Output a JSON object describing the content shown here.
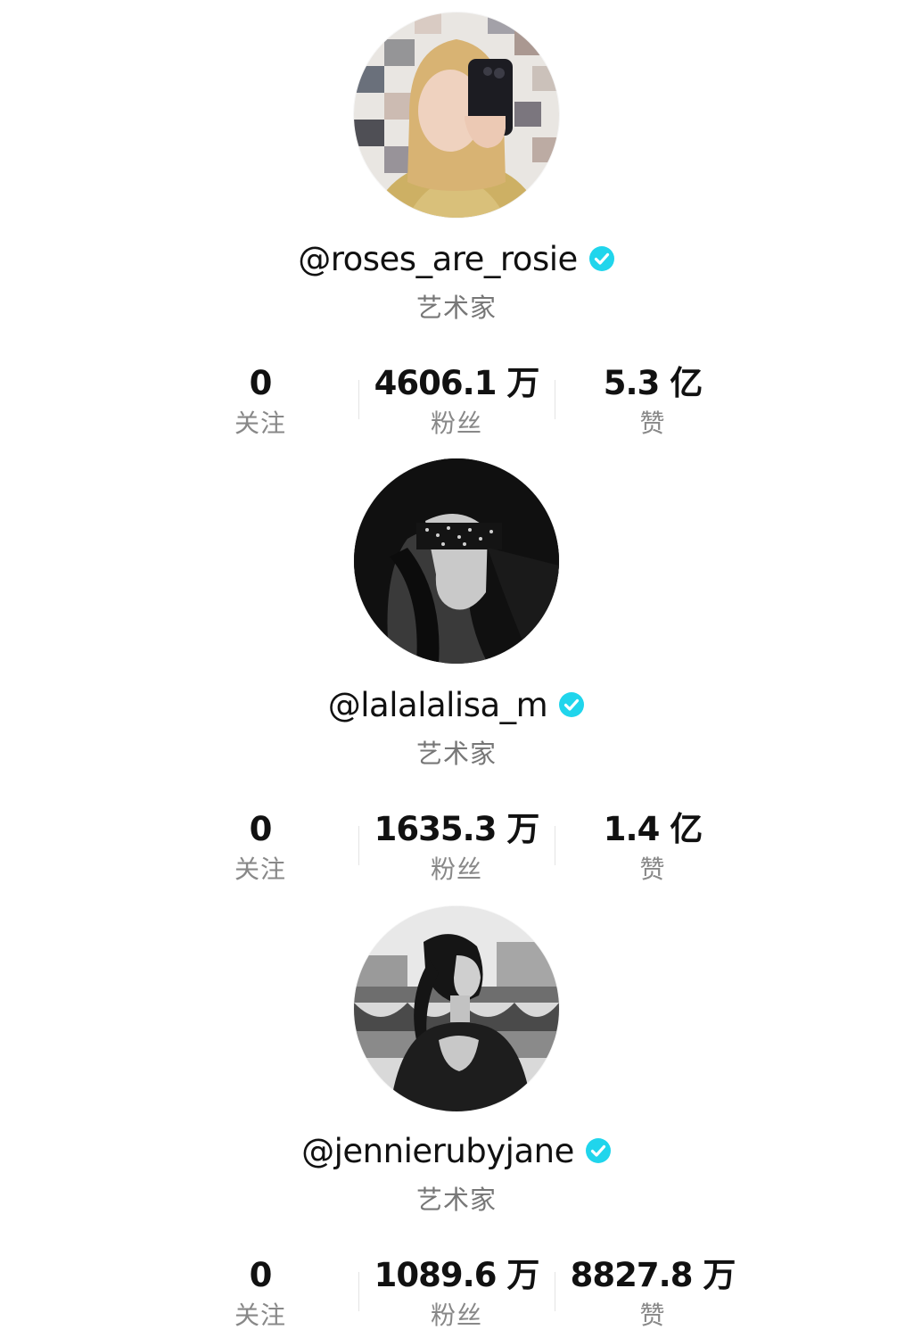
{
  "profiles": [
    {
      "handle": "@roses_are_rosie",
      "verified": true,
      "role": "艺术家",
      "avatar_icon": "avatar-photo",
      "stats": [
        {
          "value": "0",
          "label": "关注"
        },
        {
          "value": "4606.1 万",
          "label": "粉丝"
        },
        {
          "value": "5.3 亿",
          "label": "赞"
        }
      ]
    },
    {
      "handle": "@lalalalisa_m",
      "verified": true,
      "role": "艺术家",
      "avatar_icon": "avatar-photo",
      "stats": [
        {
          "value": "0",
          "label": "关注"
        },
        {
          "value": "1635.3 万",
          "label": "粉丝"
        },
        {
          "value": "1.4 亿",
          "label": "赞"
        }
      ]
    },
    {
      "handle": "@jennierubyjane",
      "verified": true,
      "role": "艺术家",
      "avatar_icon": "avatar-photo",
      "stats": [
        {
          "value": "0",
          "label": "关注"
        },
        {
          "value": "1089.6 万",
          "label": "粉丝"
        },
        {
          "value": "8827.8 万",
          "label": "赞"
        }
      ]
    }
  ],
  "colors": {
    "verified_badge": "#20d5ec",
    "text_primary": "#111111",
    "text_secondary": "#777777"
  }
}
